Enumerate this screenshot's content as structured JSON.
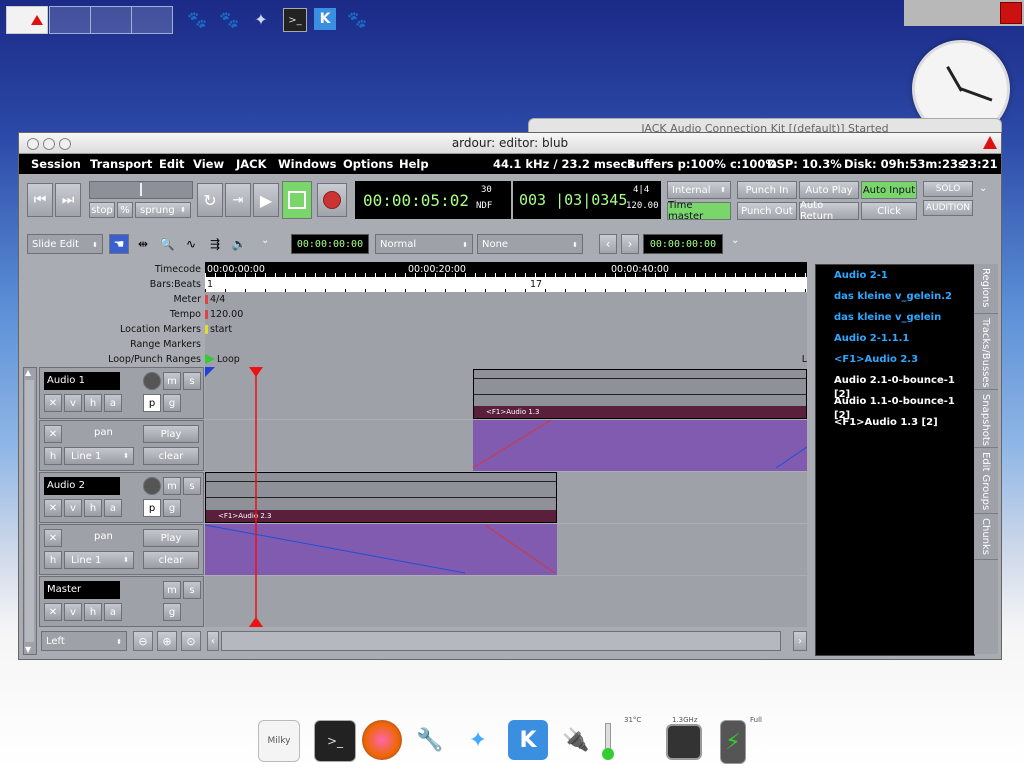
{
  "window": {
    "title": "ardour: editor: blub",
    "behind_title": "JACK Audio Connection Kit [(default)] Started"
  },
  "menu": {
    "items": [
      "Session",
      "Transport",
      "Edit",
      "View",
      "JACK",
      "Windows",
      "Options",
      "Help"
    ],
    "rate": "44.1 kHz / 23.2 msecs",
    "buffers": "Buffers p:100% c:100%",
    "dsp": "DSP: 10.3%",
    "disk": "Disk: 09h:53m:23s",
    "time": "23:21"
  },
  "transport": {
    "shuttle_stop": "stop",
    "shuttle_percent": "%",
    "shuttle_mode": "sprung",
    "primary_clock": "00:00:05:02",
    "primary_fps": "30",
    "primary_ndf": "NDF",
    "secondary_clock": "003 |03|0345",
    "secondary_meter": "4|4",
    "secondary_tempo": "120.00",
    "sync_source": "Internal",
    "time_master": "Time master",
    "punch_in": "Punch In",
    "punch_out": "Punch Out",
    "auto_play": "Auto Play",
    "auto_return": "Auto Return",
    "auto_input": "Auto Input",
    "click": "Click",
    "solo": "SOLO",
    "audition": "AUDITION"
  },
  "toolbar": {
    "edit_mode": "Slide Edit",
    "nudge_clock": "00:00:00:00",
    "snap_mode": "Normal",
    "snap_type": "None",
    "edit_clock": "00:00:00:00"
  },
  "rulers": {
    "labels": [
      "Timecode",
      "Bars:Beats",
      "Meter",
      "Tempo",
      "Location Markers",
      "Range Markers",
      "Loop/Punch Ranges"
    ],
    "timecode_ticks": [
      "00:00:00:00",
      "00:00:20:00",
      "00:00:40:00"
    ],
    "bbt_ticks": [
      "1",
      "17"
    ],
    "meter": "4/4",
    "tempo": "120.00",
    "location_marker": "start",
    "loop_marker": "Loop",
    "loop_end": "L"
  },
  "tracks": [
    {
      "name": "Audio 1",
      "region": "<F1>Audio 1.3"
    },
    {
      "name": "Audio 2",
      "region": "<F1>Audio 2.3"
    },
    {
      "name": "Master"
    }
  ],
  "track_buttons": {
    "m": "m",
    "s": "s",
    "v": "v",
    "h": "h",
    "a": "a",
    "p": "p",
    "g": "g",
    "pan": "pan",
    "play": "Play",
    "clear": "clear",
    "line": "Line 1"
  },
  "bottom": {
    "zoom_focus": "Left"
  },
  "regions_list": [
    {
      "name": "Audio 2-1",
      "color": "#2ea8ff"
    },
    {
      "name": "das kleine v_gelein.2",
      "color": "#2ea8ff"
    },
    {
      "name": "das kleine v_gelein",
      "color": "#2ea8ff"
    },
    {
      "name": "Audio 2-1.1.1",
      "color": "#2ea8ff"
    },
    {
      "name": "<F1>Audio 2.3",
      "color": "#2ea8ff"
    },
    {
      "name": "Audio 2.1-0-bounce-1  [2]",
      "color": "#ffffff"
    },
    {
      "name": "Audio 1.1-0-bounce-1  [2]",
      "color": "#ffffff"
    },
    {
      "name": "<F1>Audio 1.3  [2]",
      "color": "#ffffff"
    }
  ],
  "side_tabs": [
    "Regions",
    "Tracks/Busses",
    "Snapshots",
    "Edit Groups",
    "Chunks"
  ],
  "dock": {
    "temp": "31°C",
    "cpu": "1.3GHz",
    "battery": "Full"
  }
}
